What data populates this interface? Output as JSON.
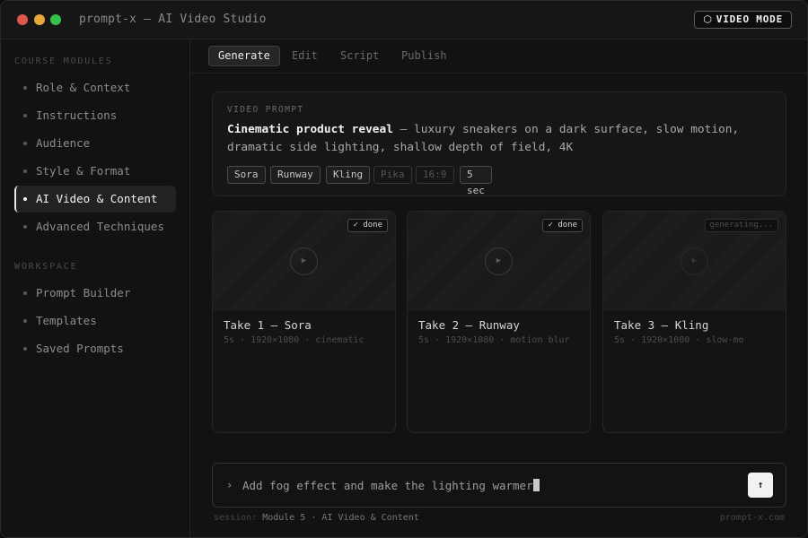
{
  "window": {
    "title": "prompt-x — AI Video Studio",
    "mode_badge": {
      "icon": "⬡",
      "label": "VIDEO MODE"
    }
  },
  "sidebar": {
    "sections": [
      {
        "title": "COURSE MODULES",
        "items": [
          {
            "label": "Role & Context"
          },
          {
            "label": "Instructions"
          },
          {
            "label": "Audience"
          },
          {
            "label": "Style & Format"
          },
          {
            "label": "AI Video & Content",
            "active": true
          },
          {
            "label": "Advanced Techniques"
          }
        ]
      },
      {
        "title": "WORKSPACE",
        "items": [
          {
            "label": "Prompt Builder"
          },
          {
            "label": "Templates"
          },
          {
            "label": "Saved Prompts"
          }
        ]
      }
    ]
  },
  "tabs": [
    {
      "label": "Generate",
      "active": true
    },
    {
      "label": "Edit"
    },
    {
      "label": "Script"
    },
    {
      "label": "Publish"
    }
  ],
  "prompt": {
    "label": "VIDEO PROMPT",
    "title": "Cinematic product reveal",
    "separator": " — ",
    "body": "luxury sneakers on a dark surface, slow motion, dramatic side lighting, shallow depth of field, 4K",
    "chips": [
      {
        "label": "Sora",
        "selected": true
      },
      {
        "label": "Runway",
        "selected": true
      },
      {
        "label": "Kling",
        "selected": true
      },
      {
        "label": "Pika",
        "selected": false
      },
      {
        "label": "16:9",
        "selected": false
      },
      {
        "label": "5 sec",
        "selected": true
      }
    ]
  },
  "takes": [
    {
      "title": "Take 1 — Sora",
      "meta": "5s · 1920×1080 · cinematic",
      "status": "✓ done",
      "done": true
    },
    {
      "title": "Take 2 — Runway",
      "meta": "5s · 1920×1080 · motion blur",
      "status": "✓ done",
      "done": true
    },
    {
      "title": "Take 3 — Kling",
      "meta": "5s · 1920×1080 · slow-mo",
      "status": "generating...",
      "done": false
    }
  ],
  "input": {
    "prompt_symbol": "›",
    "value": "Add fog effect and make the lighting warmer",
    "send_icon": "↑"
  },
  "footer": {
    "session_label": "session:",
    "session_value": "Module 5 · AI Video & Content",
    "site": "prompt-x.com"
  },
  "colors": {
    "background": "#111111",
    "accent": "#f2f2f2",
    "traffic_red": "#e0574a",
    "traffic_yellow": "#e6a93a",
    "traffic_green": "#35c04b"
  }
}
